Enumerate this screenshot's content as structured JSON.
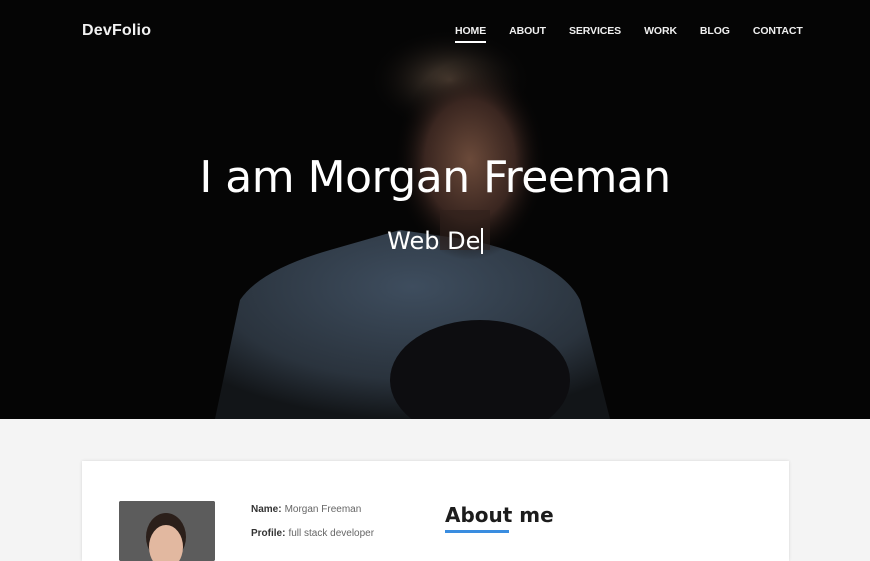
{
  "brand": "DevFolio",
  "nav": [
    {
      "label": "HOME",
      "active": true
    },
    {
      "label": "ABOUT",
      "active": false
    },
    {
      "label": "SERVICES",
      "active": false
    },
    {
      "label": "WORK",
      "active": false
    },
    {
      "label": "BLOG",
      "active": false
    },
    {
      "label": "CONTACT",
      "active": false
    }
  ],
  "hero": {
    "title": "I am Morgan Freeman",
    "typed_text": "Web De"
  },
  "about": {
    "title": "About me",
    "accent_color": "#3a8de0",
    "info": [
      {
        "label": "Name:",
        "value": "Morgan Freeman"
      },
      {
        "label": "Profile:",
        "value": "full stack developer"
      }
    ]
  }
}
